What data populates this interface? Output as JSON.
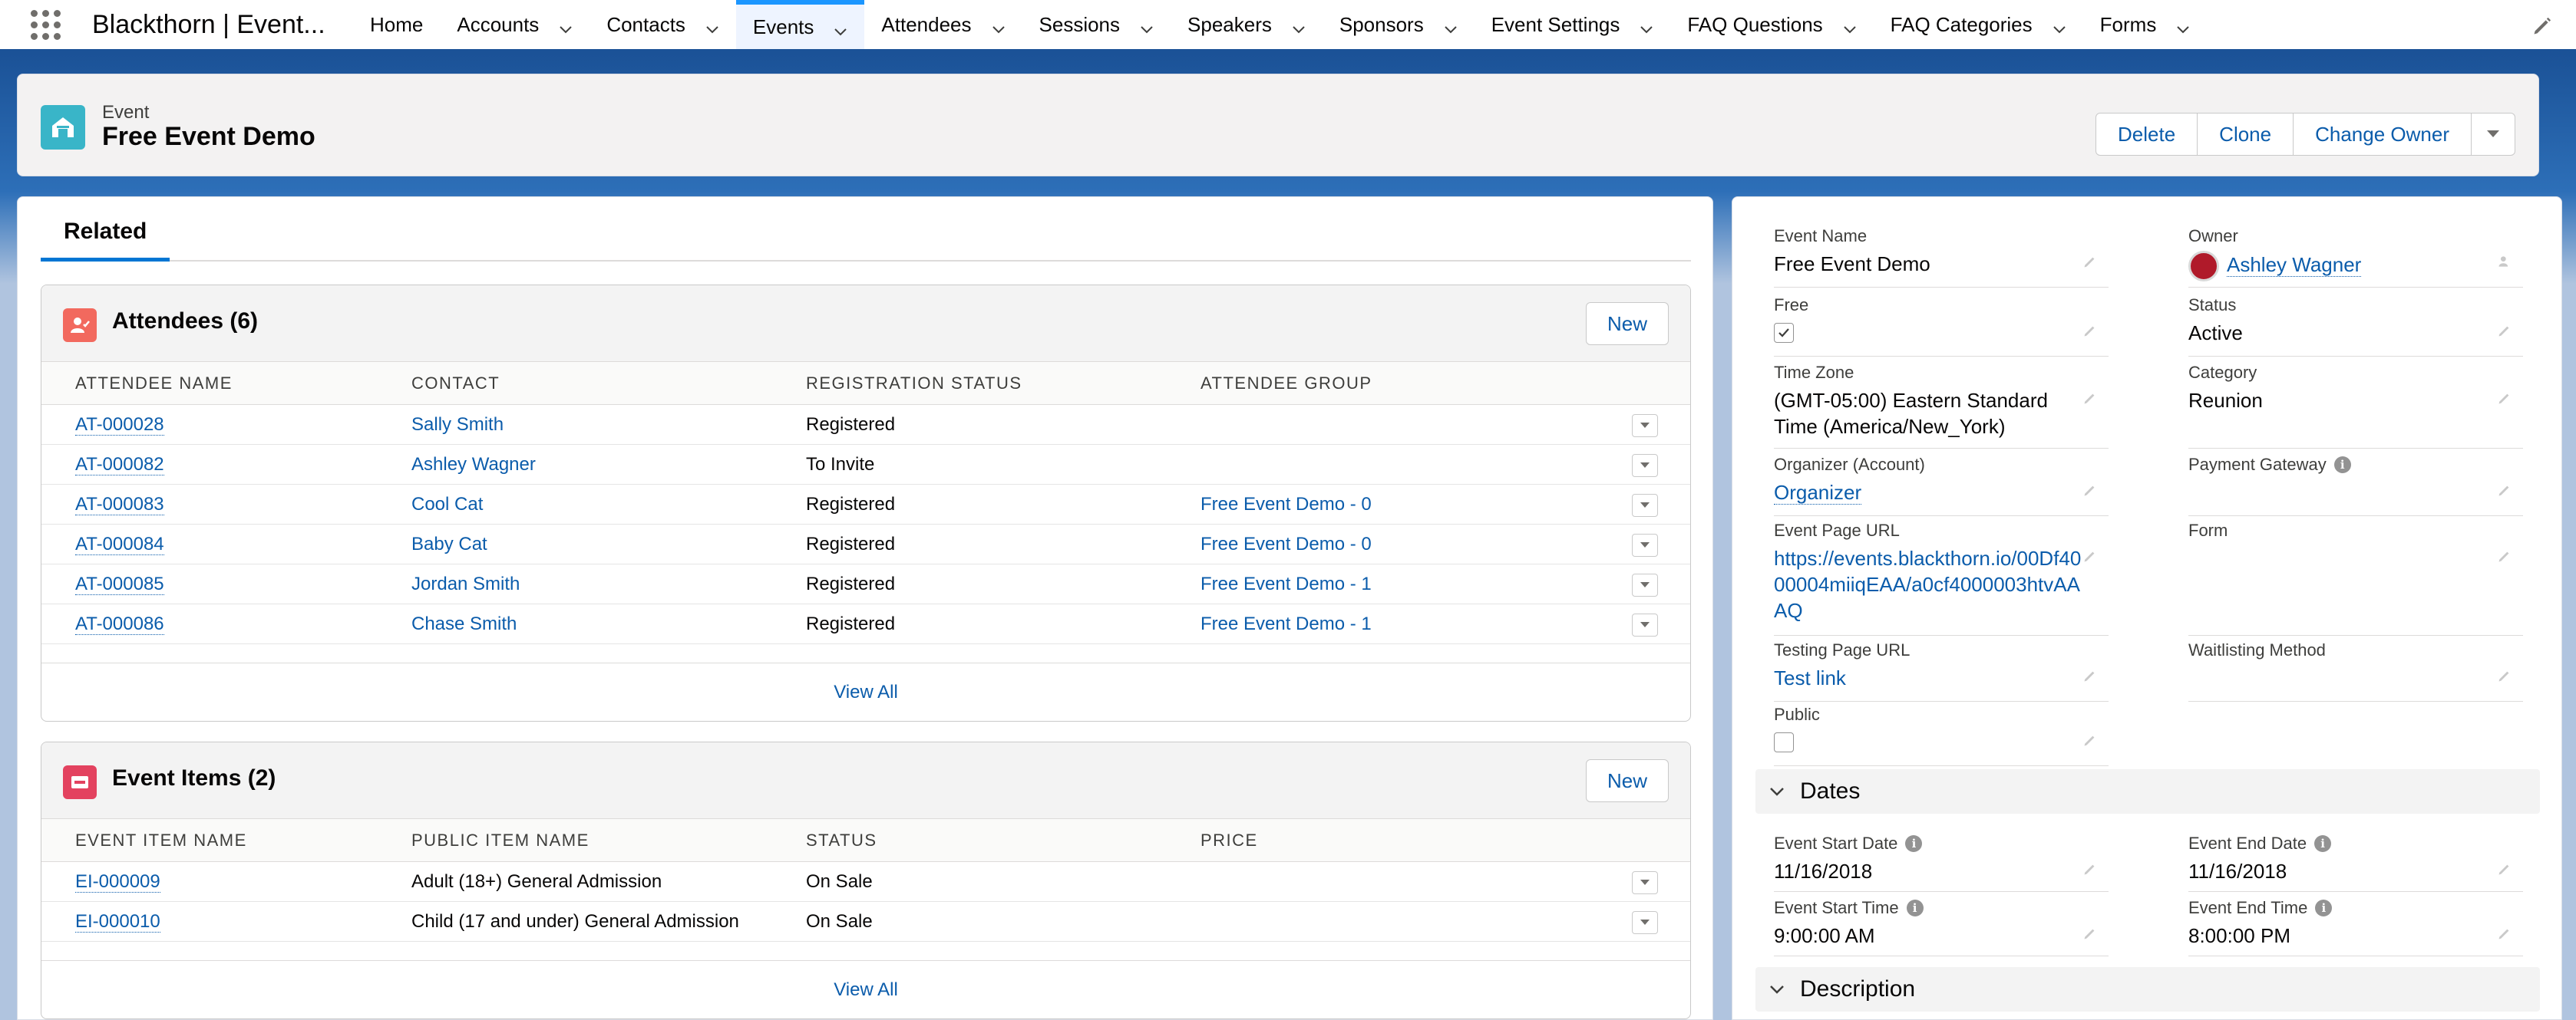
{
  "app": {
    "name": "Blackthorn | Event...",
    "nav": [
      {
        "label": "Home",
        "has_menu": false,
        "active": false
      },
      {
        "label": "Accounts",
        "has_menu": true,
        "active": false
      },
      {
        "label": "Contacts",
        "has_menu": true,
        "active": false
      },
      {
        "label": "Events",
        "has_menu": true,
        "active": true
      },
      {
        "label": "Attendees",
        "has_menu": true,
        "active": false
      },
      {
        "label": "Sessions",
        "has_menu": true,
        "active": false
      },
      {
        "label": "Speakers",
        "has_menu": true,
        "active": false
      },
      {
        "label": "Sponsors",
        "has_menu": true,
        "active": false
      },
      {
        "label": "Event Settings",
        "has_menu": true,
        "active": false
      },
      {
        "label": "FAQ Questions",
        "has_menu": true,
        "active": false
      },
      {
        "label": "FAQ Categories",
        "has_menu": true,
        "active": false
      },
      {
        "label": "Forms",
        "has_menu": true,
        "active": false
      }
    ]
  },
  "record": {
    "type": "Event",
    "title": "Free Event Demo",
    "actions": {
      "delete": "Delete",
      "clone": "Clone",
      "change_owner": "Change Owner"
    }
  },
  "tabs": {
    "related": "Related"
  },
  "attendees": {
    "title": "Attendees (6)",
    "new_label": "New",
    "columns": [
      "ATTENDEE NAME",
      "CONTACT",
      "REGISTRATION STATUS",
      "ATTENDEE GROUP"
    ],
    "rows": [
      {
        "name": "AT-000028",
        "contact": "Sally Smith",
        "status": "Registered",
        "group": ""
      },
      {
        "name": "AT-000082",
        "contact": "Ashley Wagner",
        "status": "To Invite",
        "group": ""
      },
      {
        "name": "AT-000083",
        "contact": "Cool Cat",
        "status": "Registered",
        "group": "Free Event Demo - 0"
      },
      {
        "name": "AT-000084",
        "contact": "Baby Cat",
        "status": "Registered",
        "group": "Free Event Demo - 0"
      },
      {
        "name": "AT-000085",
        "contact": "Jordan Smith",
        "status": "Registered",
        "group": "Free Event Demo - 1"
      },
      {
        "name": "AT-000086",
        "contact": "Chase Smith",
        "status": "Registered",
        "group": "Free Event Demo - 1"
      }
    ],
    "view_all": "View All"
  },
  "event_items": {
    "title": "Event Items (2)",
    "new_label": "New",
    "columns": [
      "EVENT ITEM NAME",
      "PUBLIC ITEM NAME",
      "STATUS",
      "PRICE"
    ],
    "rows": [
      {
        "name": "EI-000009",
        "public": "Adult (18+) General Admission",
        "status": "On Sale",
        "price": ""
      },
      {
        "name": "EI-000010",
        "public": "Child (17 and under) General Admission",
        "status": "On Sale",
        "price": ""
      }
    ],
    "view_all": "View All"
  },
  "details": {
    "event_name": {
      "label": "Event Name",
      "value": "Free Event Demo"
    },
    "owner": {
      "label": "Owner",
      "value": "Ashley Wagner"
    },
    "free": {
      "label": "Free",
      "checked": true
    },
    "status": {
      "label": "Status",
      "value": "Active"
    },
    "time_zone": {
      "label": "Time Zone",
      "value": "(GMT-05:00) Eastern Standard Time (America/New_York)"
    },
    "category": {
      "label": "Category",
      "value": "Reunion"
    },
    "organizer": {
      "label": "Organizer (Account)",
      "value": "Organizer"
    },
    "payment_gateway": {
      "label": "Payment Gateway",
      "value": ""
    },
    "event_page_url": {
      "label": "Event Page URL",
      "value": "https://events.blackthorn.io/00Df4000004miiqEAA/a0cf4000003htvAAAQ"
    },
    "form": {
      "label": "Form",
      "value": ""
    },
    "testing_page_url": {
      "label": "Testing Page URL",
      "value": "Test link"
    },
    "waitlisting_method": {
      "label": "Waitlisting Method",
      "value": ""
    },
    "public": {
      "label": "Public",
      "checked": false
    }
  },
  "dates": {
    "title": "Dates",
    "start_date": {
      "label": "Event Start Date",
      "value": "11/16/2018"
    },
    "end_date": {
      "label": "Event End Date",
      "value": "11/16/2018"
    },
    "start_time": {
      "label": "Event Start Time",
      "value": "9:00:00 AM"
    },
    "end_time": {
      "label": "Event End Time",
      "value": "8:00:00 PM"
    }
  },
  "description": {
    "title": "Description"
  },
  "colors": {
    "brand": "#0176d3",
    "link": "#0b5cab",
    "attendee_icon": "#f2695e",
    "item_icon": "#e3425f",
    "event_icon": "#39b5c8"
  }
}
